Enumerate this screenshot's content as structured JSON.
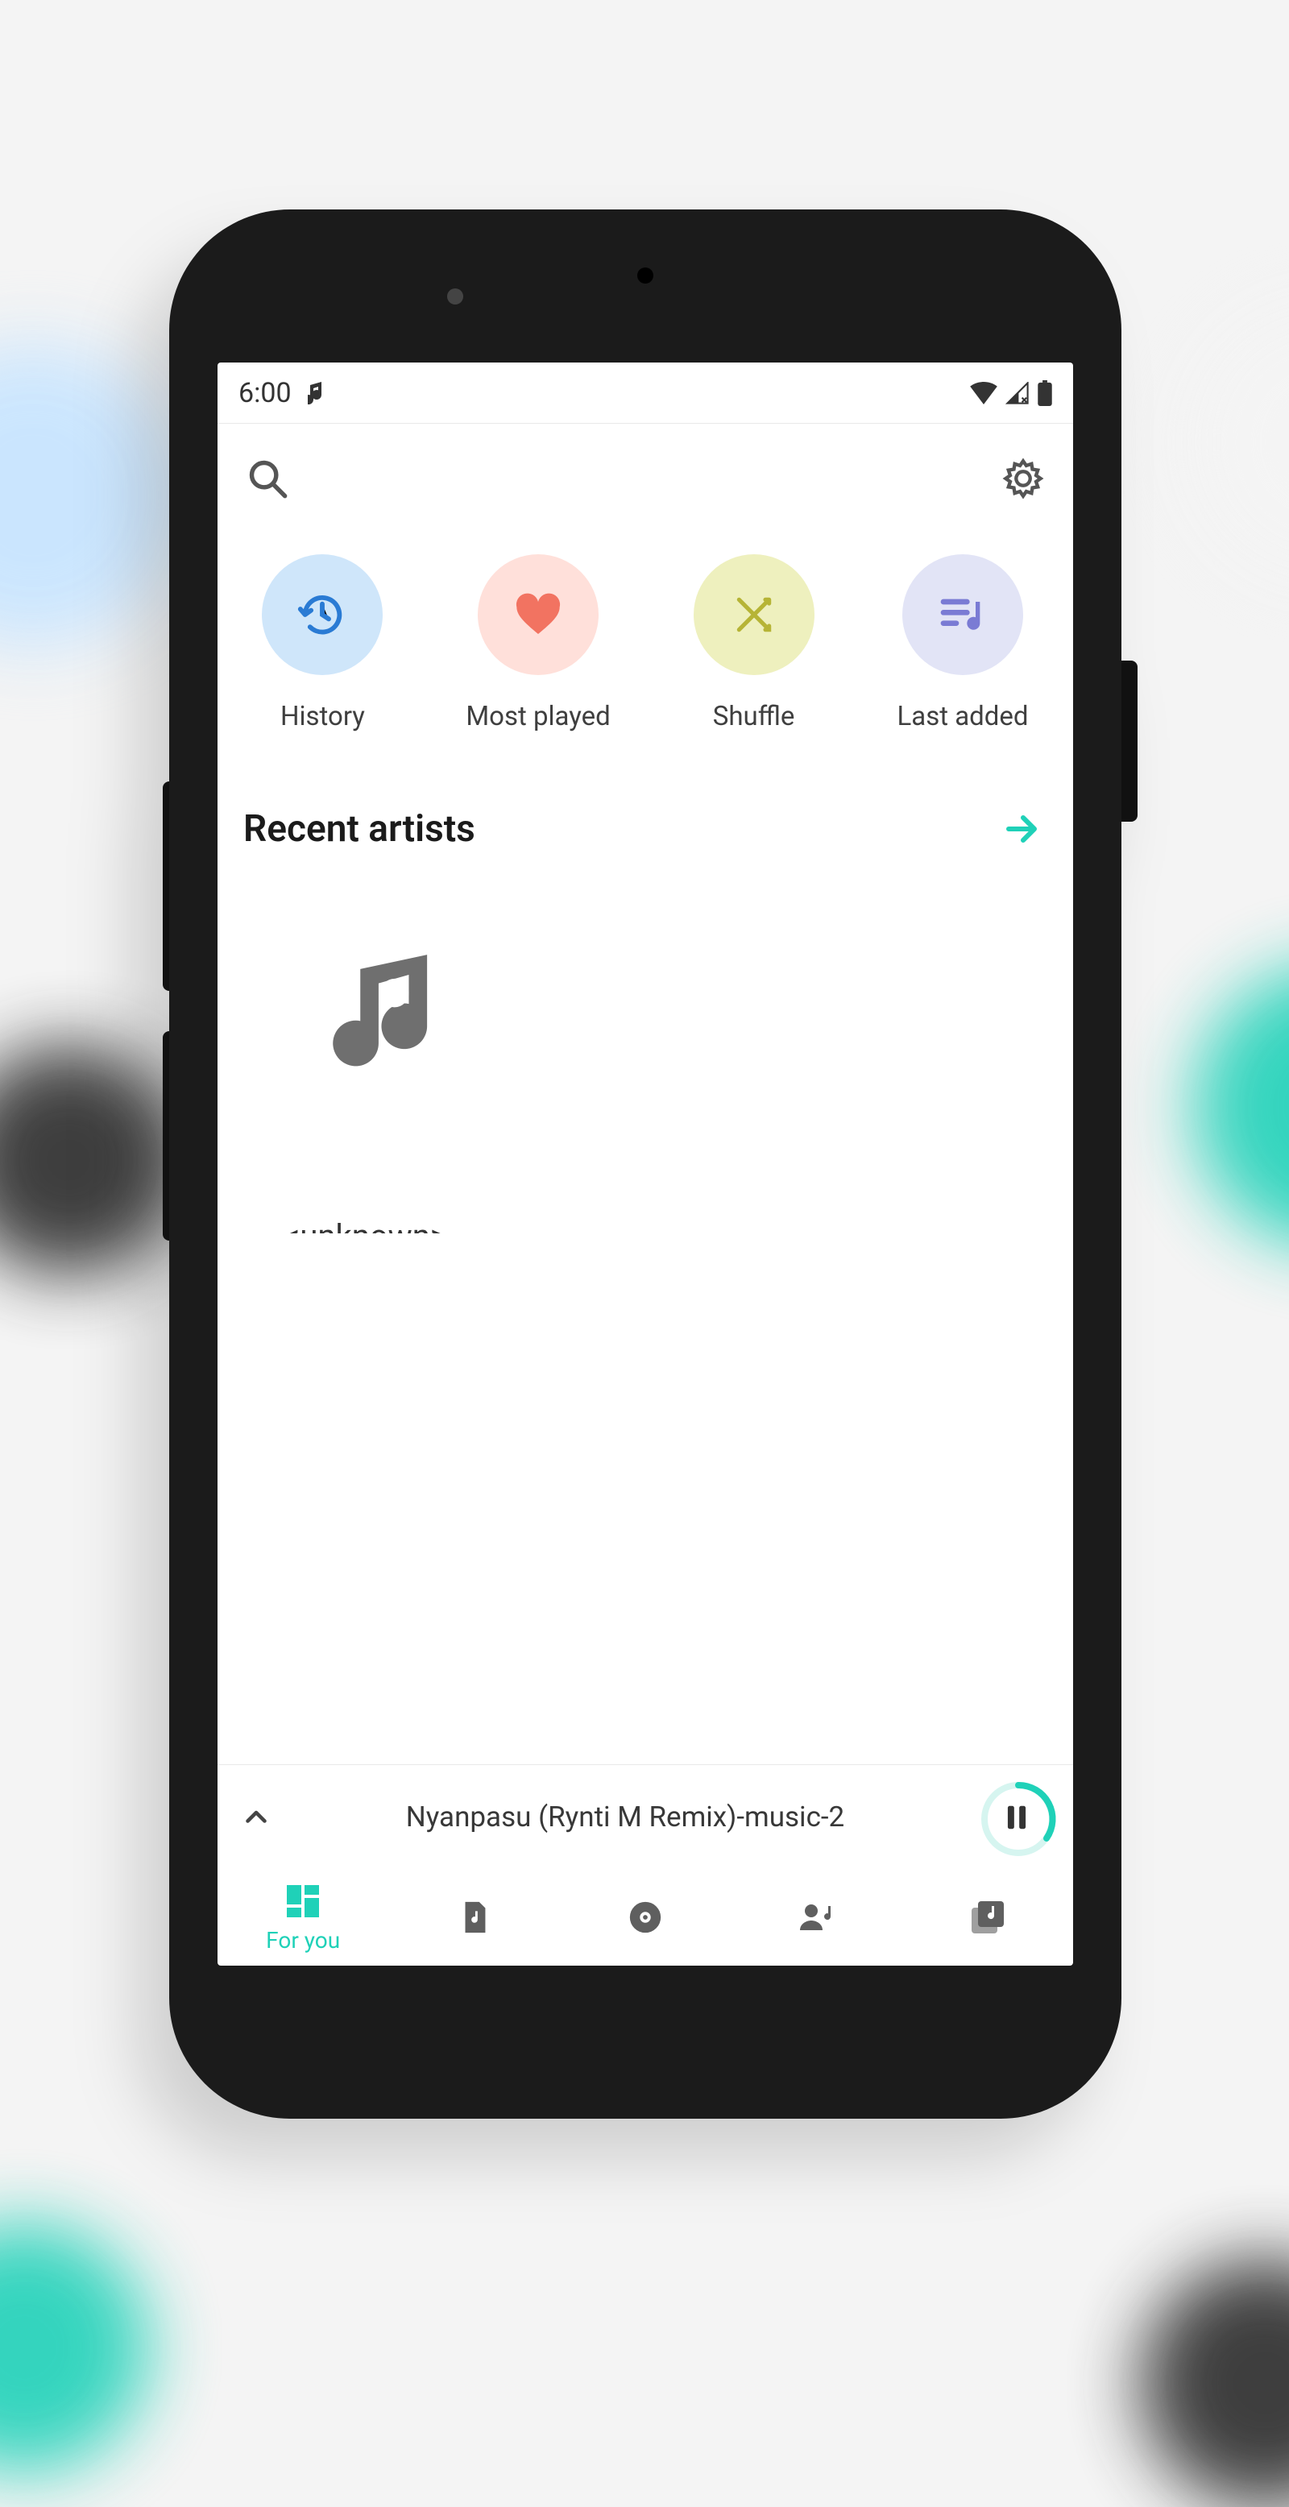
{
  "status": {
    "time": "6:00"
  },
  "quick": {
    "history": "History",
    "most_played": "Most played",
    "shuffle": "Shuffle",
    "last_added": "Last added"
  },
  "recent_artists": {
    "title": "Recent artists",
    "items": [
      "<unknown>"
    ]
  },
  "now_playing": {
    "title": "Nyanpasu (Rynti M Remix)-music-2",
    "progress_pct": 55
  },
  "tabs": {
    "for_you": "For you"
  },
  "colors": {
    "accent": "#1fd1b8"
  }
}
